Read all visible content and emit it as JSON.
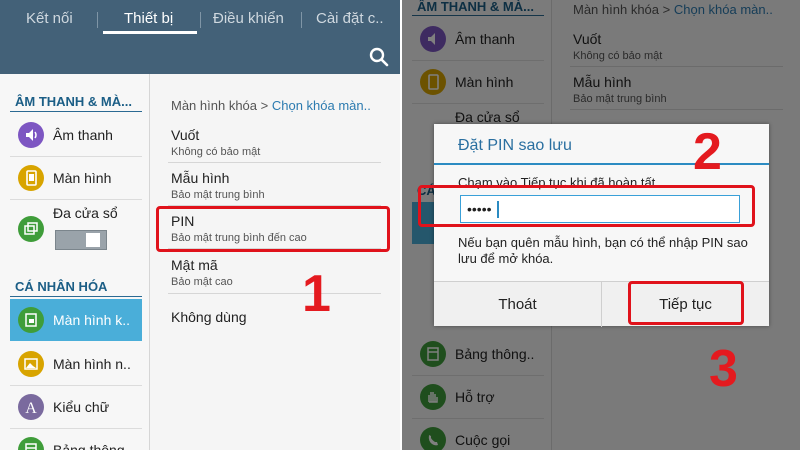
{
  "left": {
    "tabs": [
      {
        "label": "Kết nối"
      },
      {
        "label": "Thiết bị"
      },
      {
        "label": "Điều khiển"
      },
      {
        "label": "Cài đặt c.."
      }
    ],
    "sidebar": {
      "section1_title": "ÂM THANH & MÀ...",
      "items": [
        {
          "label": "Âm thanh",
          "icon": "speaker-icon",
          "color": "#7d56c2"
        },
        {
          "label": "Màn hình",
          "icon": "phone-screen-icon",
          "color": "#d8a400"
        },
        {
          "label": "Đa cửa sổ",
          "icon": "multi-window-icon",
          "color": "#3f9d3a"
        }
      ],
      "section2_title": "CÁ NHÂN HÓA",
      "items2": [
        {
          "label": "Màn hình k..",
          "icon": "lock-screen-icon",
          "color": "#3f9d3a"
        },
        {
          "label": "Màn hình n..",
          "icon": "wallpaper-icon",
          "color": "#d8a400"
        },
        {
          "label": "Kiểu chữ",
          "icon": "font-icon",
          "color": "#7a6a9e"
        },
        {
          "label": "Bảng thông..",
          "icon": "notification-panel-icon",
          "color": "#3f9d3a"
        }
      ]
    },
    "content": {
      "breadcrumb_parent": "Màn hình khóa",
      "breadcrumb_sep": ">",
      "breadcrumb_current": "Chọn khóa màn..",
      "options": [
        {
          "title": "Vuốt",
          "sub": "Không có bảo mật"
        },
        {
          "title": "Mẫu hình",
          "sub": "Bảo mật trung bình"
        },
        {
          "title": "PIN",
          "sub": "Bảo mật trung bình đến cao"
        },
        {
          "title": "Mật mã",
          "sub": "Bảo mật cao"
        },
        {
          "title": "Không dùng",
          "sub": ""
        }
      ]
    },
    "step_number": "1"
  },
  "right": {
    "sidebar": {
      "section1_title": "ÂM THANH & MÀ...",
      "items": [
        {
          "label": "Âm thanh",
          "icon": "speaker-icon",
          "color": "#7d56c2"
        },
        {
          "label": "Màn hình",
          "icon": "phone-screen-icon",
          "color": "#d8a400"
        },
        {
          "label": "Đa cửa sổ",
          "icon": "multi-window-icon",
          "color": "#3f9d3a"
        }
      ],
      "section2_title": "CÁ",
      "items2": [
        {
          "label": "Bảng thông..",
          "icon": "notification-panel-icon",
          "color": "#3f9d3a"
        },
        {
          "label": "Hỗ trợ",
          "icon": "hand-icon",
          "color": "#3f9d3a"
        },
        {
          "label": "Cuộc gọi",
          "icon": "phone-icon",
          "color": "#3f9d3a"
        }
      ]
    },
    "content": {
      "breadcrumb_parent": "Màn hình khóa",
      "breadcrumb_sep": ">",
      "breadcrumb_current": "Chọn khóa màn..",
      "options": [
        {
          "title": "Vuốt",
          "sub": "Không có bảo mật"
        },
        {
          "title": "Mẫu hình",
          "sub": "Bảo mật trung bình"
        }
      ]
    },
    "dialog": {
      "title": "Đặt PIN sao lưu",
      "instruction": "Chạm vào Tiếp tục khi đã hoàn tất",
      "pin_value": "•••••",
      "hint": "Nếu bạn quên mẫu hình, bạn có thể nhập PIN sao lưu để mở khóa.",
      "cancel_label": "Thoát",
      "continue_label": "Tiếp tục"
    },
    "step_numbers": [
      "2",
      "3"
    ]
  },
  "colors": {
    "header": "#436178",
    "accent": "#2b8bc2",
    "selected": "#4aaed9",
    "highlight": "#e0121b"
  }
}
